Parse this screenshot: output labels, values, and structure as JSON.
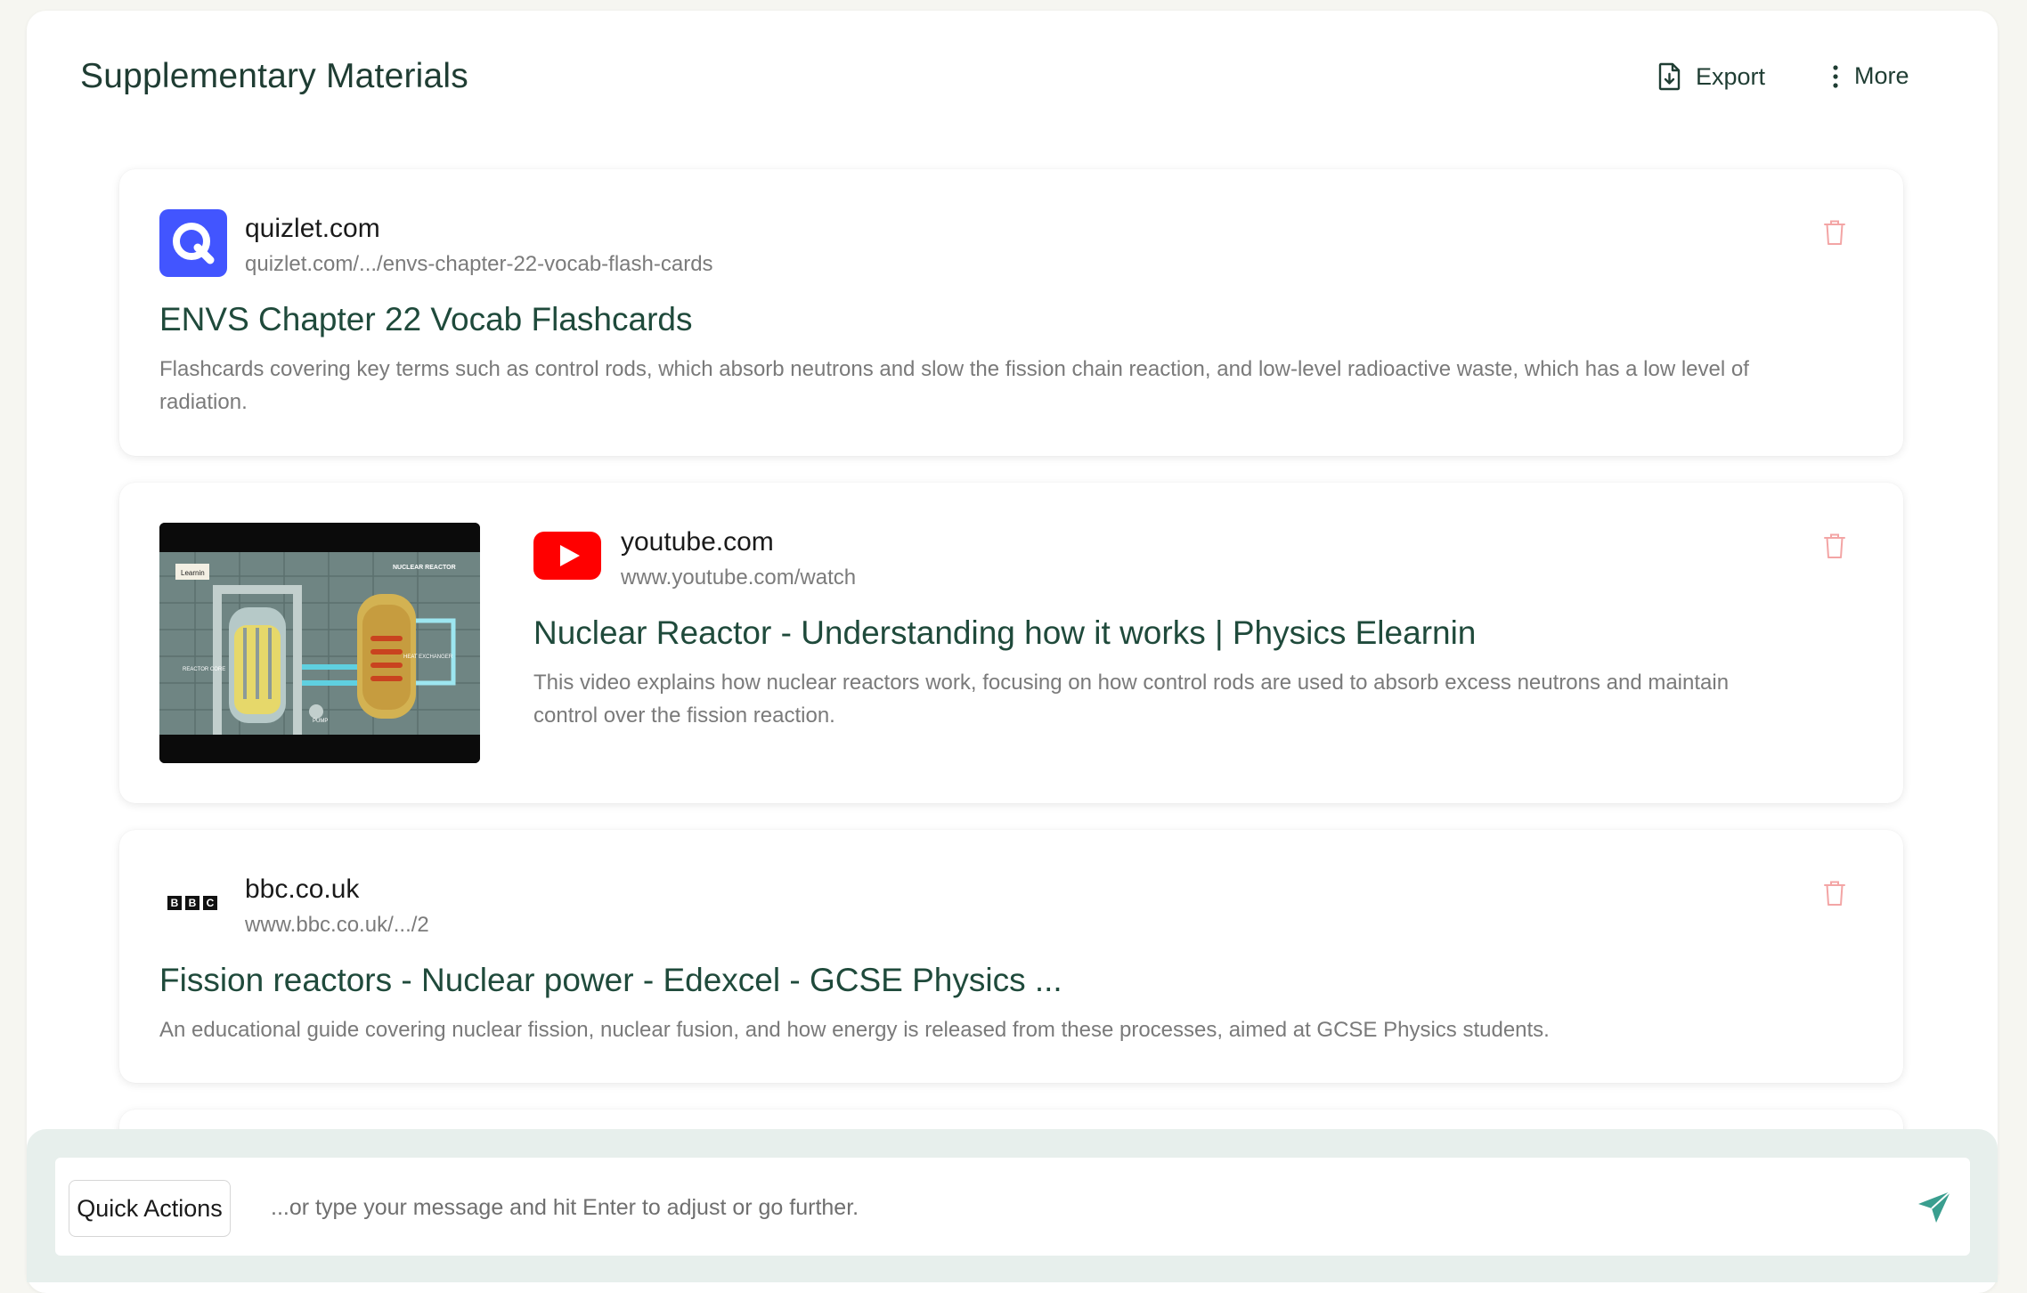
{
  "header": {
    "title": "Supplementary Materials",
    "export_label": "Export",
    "more_label": "More"
  },
  "resources": [
    {
      "site": "quizlet.com",
      "url": "quizlet.com/.../envs-chapter-22-vocab-flash-cards",
      "title": "ENVS Chapter 22 Vocab Flashcards",
      "description": "Flashcards covering key terms such as control rods, which absorb neutrons and slow the fission chain reaction, and low-level radioactive waste, which has a low level of radiation.",
      "logo": "quizlet-logo"
    },
    {
      "site": "youtube.com",
      "url": "www.youtube.com/watch",
      "title": "Nuclear Reactor - Understanding how it works | Physics Elearnin",
      "description": "This video explains how nuclear reactors work, focusing on how control rods are used to absorb excess neutrons and maintain control over the fission reaction.",
      "logo": "youtube-logo",
      "thumbnail": {
        "label_top": "NUCLEAR REACTOR",
        "label_core": "REACTOR CORE",
        "label_heat": "HEAT EXCHANGER",
        "label_pump": "PUMP",
        "badge": "Learnin"
      }
    },
    {
      "site": "bbc.co.uk",
      "url": "www.bbc.co.uk/.../2",
      "title": "Fission reactors - Nuclear power - Edexcel - GCSE Physics ...",
      "description": "An educational guide covering nuclear fission, nuclear fusion, and how energy is released from these processes, aimed at GCSE Physics students.",
      "logo": "bbc-logo",
      "logo_letters": [
        "B",
        "B",
        "C"
      ]
    }
  ],
  "composer": {
    "quick_actions_label": "Quick Actions",
    "placeholder": "...or type your message and hit Enter to adjust or go further."
  },
  "colors": {
    "title_green": "#1f4a3b",
    "quizlet_blue": "#4255ff",
    "youtube_red": "#ff0000",
    "trash_red": "#f3a5a5",
    "send_teal": "#3a9e8f"
  }
}
